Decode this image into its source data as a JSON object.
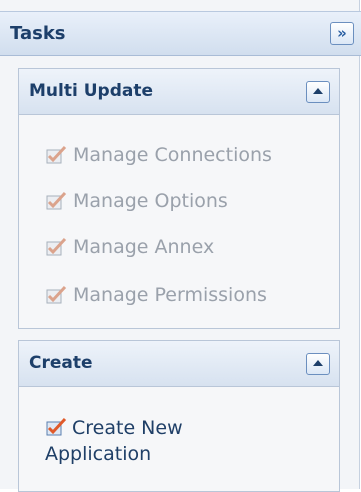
{
  "tasks": {
    "title": "Tasks",
    "collapse_glyph": "»"
  },
  "sections": {
    "multi_update": {
      "title": "Multi Update",
      "items": [
        {
          "label": "Manage Connections",
          "icon": "checkbox-icon",
          "enabled": false
        },
        {
          "label": "Manage Options",
          "icon": "checkbox-icon",
          "enabled": false
        },
        {
          "label": "Manage Annex",
          "icon": "checkbox-icon",
          "enabled": false
        },
        {
          "label": "Manage Permissions",
          "icon": "checkbox-icon",
          "enabled": false
        }
      ]
    },
    "create": {
      "title": "Create",
      "items": [
        {
          "label": "Create New Application",
          "icon": "checkbox-icon",
          "enabled": true
        }
      ]
    }
  },
  "colors": {
    "header_text": "#1d3f6a",
    "disabled_text": "#9aa1ab",
    "accent_check": "#e05a2a",
    "link_text": "#1f3f67"
  }
}
